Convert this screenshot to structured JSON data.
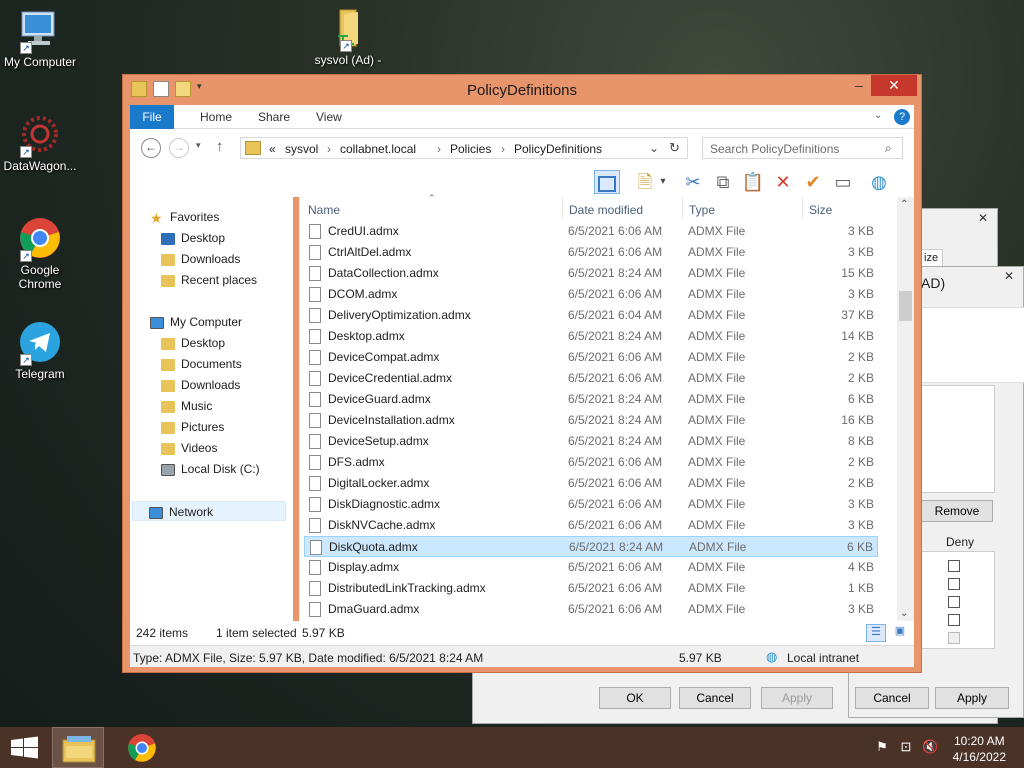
{
  "desktop": {
    "icons": [
      {
        "label": "My Computer"
      },
      {
        "label": "DataWagon..."
      },
      {
        "label": "Google Chrome"
      },
      {
        "label": "Telegram"
      },
      {
        "label": "sysvol (Ad) -"
      }
    ]
  },
  "background_dialog": {
    "tab_partial": "ize",
    "title_partial": "AD)",
    "remove_label": "Remove",
    "deny_header": "Deny",
    "ok_label": "OK",
    "cancel_label": "Cancel",
    "apply_label": "Apply",
    "cancel2_label": "Cancel",
    "apply2_label": "Apply"
  },
  "explorer": {
    "title": "PolicyDefinitions",
    "minimize": "–",
    "close": "✕",
    "ribbon_tabs": [
      "File",
      "Home",
      "Share",
      "View"
    ],
    "help": "?",
    "address": {
      "prefix": "«",
      "crumbs": [
        "sysvol",
        "collabnet.local",
        "Policies",
        "PolicyDefinitions"
      ]
    },
    "search_placeholder": "Search PolicyDefinitions",
    "nav": {
      "favorites_header": "Favorites",
      "favorites": [
        "Desktop",
        "Downloads",
        "Recent places"
      ],
      "computer_header": "My Computer",
      "computer": [
        "Desktop",
        "Documents",
        "Downloads",
        "Music",
        "Pictures",
        "Videos",
        "Local Disk (C:)"
      ],
      "network": "Network"
    },
    "columns": {
      "name": "Name",
      "date": "Date modified",
      "type": "Type",
      "size": "Size"
    },
    "files": [
      {
        "name": "CredUI.admx",
        "date": "6/5/2021 6:06 AM",
        "type": "ADMX File",
        "size": "3 KB"
      },
      {
        "name": "CtrlAltDel.admx",
        "date": "6/5/2021 6:06 AM",
        "type": "ADMX File",
        "size": "3 KB"
      },
      {
        "name": "DataCollection.admx",
        "date": "6/5/2021 8:24 AM",
        "type": "ADMX File",
        "size": "15 KB"
      },
      {
        "name": "DCOM.admx",
        "date": "6/5/2021 6:06 AM",
        "type": "ADMX File",
        "size": "3 KB"
      },
      {
        "name": "DeliveryOptimization.admx",
        "date": "6/5/2021 6:04 AM",
        "type": "ADMX File",
        "size": "37 KB"
      },
      {
        "name": "Desktop.admx",
        "date": "6/5/2021 8:24 AM",
        "type": "ADMX File",
        "size": "14 KB"
      },
      {
        "name": "DeviceCompat.admx",
        "date": "6/5/2021 6:06 AM",
        "type": "ADMX File",
        "size": "2 KB"
      },
      {
        "name": "DeviceCredential.admx",
        "date": "6/5/2021 6:06 AM",
        "type": "ADMX File",
        "size": "2 KB"
      },
      {
        "name": "DeviceGuard.admx",
        "date": "6/5/2021 8:24 AM",
        "type": "ADMX File",
        "size": "6 KB"
      },
      {
        "name": "DeviceInstallation.admx",
        "date": "6/5/2021 8:24 AM",
        "type": "ADMX File",
        "size": "16 KB"
      },
      {
        "name": "DeviceSetup.admx",
        "date": "6/5/2021 8:24 AM",
        "type": "ADMX File",
        "size": "8 KB"
      },
      {
        "name": "DFS.admx",
        "date": "6/5/2021 6:06 AM",
        "type": "ADMX File",
        "size": "2 KB"
      },
      {
        "name": "DigitalLocker.admx",
        "date": "6/5/2021 6:06 AM",
        "type": "ADMX File",
        "size": "2 KB"
      },
      {
        "name": "DiskDiagnostic.admx",
        "date": "6/5/2021 6:06 AM",
        "type": "ADMX File",
        "size": "3 KB"
      },
      {
        "name": "DiskNVCache.admx",
        "date": "6/5/2021 6:06 AM",
        "type": "ADMX File",
        "size": "3 KB"
      },
      {
        "name": "DiskQuota.admx",
        "date": "6/5/2021 8:24 AM",
        "type": "ADMX File",
        "size": "6 KB"
      },
      {
        "name": "Display.admx",
        "date": "6/5/2021 6:06 AM",
        "type": "ADMX File",
        "size": "4 KB"
      },
      {
        "name": "DistributedLinkTracking.admx",
        "date": "6/5/2021 6:06 AM",
        "type": "ADMX File",
        "size": "1 KB"
      },
      {
        "name": "DmaGuard.admx",
        "date": "6/5/2021 6:06 AM",
        "type": "ADMX File",
        "size": "3 KB"
      }
    ],
    "selected_index": 15,
    "status": {
      "item_count": "242 items",
      "selection": "1 item selected",
      "selection_size": "5.97 KB",
      "details": "Type: ADMX File, Size: 5.97 KB, Date modified: 6/5/2021 8:24 AM",
      "size": "5.97 KB",
      "zone": "Local intranet"
    }
  },
  "taskbar": {
    "time": "10:20 AM",
    "date": "4/16/2022"
  },
  "colors": {
    "window_frame": "#e8956b",
    "file_tab": "#1979ca",
    "selection": "#cce8ff",
    "taskbar": "#4a3226",
    "close_button": "#c7382c"
  }
}
